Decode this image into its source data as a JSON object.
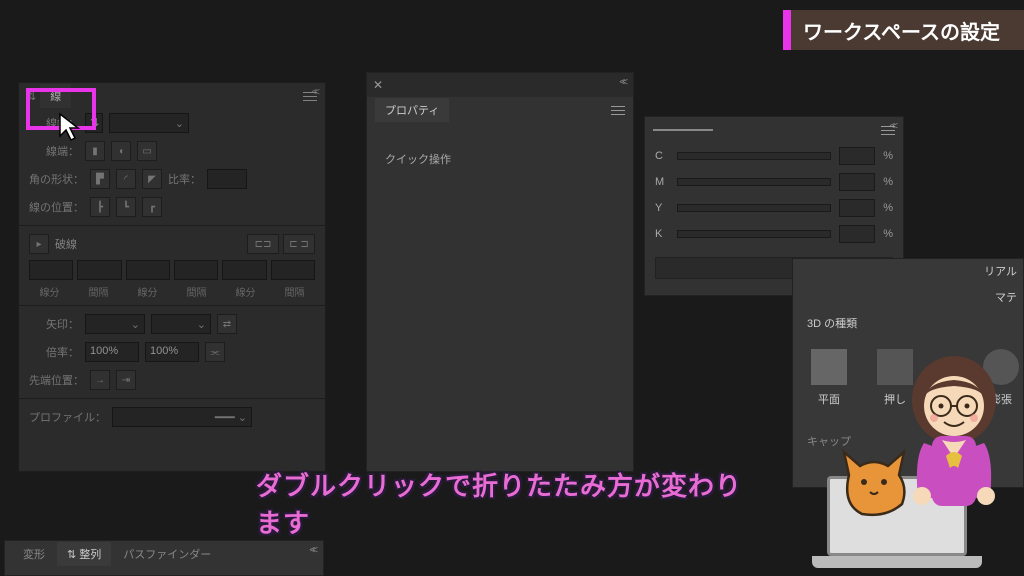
{
  "title_banner": "ワークスペースの設定",
  "subtitle": "ダブルクリックで折りたたみ方が変わります",
  "stroke_panel": {
    "tab": "線",
    "width_label": "線幅：",
    "cap_label": "線端：",
    "corner_label": "角の形状：",
    "ratio_label": "比率：",
    "align_label": "線の位置：",
    "dash_checkbox": "破線",
    "dash_headers": [
      "線分",
      "間隔",
      "線分",
      "間隔",
      "線分",
      "間隔"
    ],
    "arrow_label": "矢印：",
    "scale_label": "倍率：",
    "scale_val1": "100%",
    "scale_val2": "100%",
    "tip_label": "先端位置：",
    "profile_label": "プロファイル："
  },
  "props_panel": {
    "tab": "プロパティ",
    "quick": "クイック操作"
  },
  "color_panel": {
    "channels": [
      {
        "label": "C",
        "pct": "%"
      },
      {
        "label": "M",
        "pct": "%"
      },
      {
        "label": "Y",
        "pct": "%"
      },
      {
        "label": "K",
        "pct": "%"
      }
    ]
  },
  "d3_panel": {
    "side_tab1": "リアル",
    "side_tab2": "マテ",
    "heading": "3D の種類",
    "items": [
      "平面",
      "押し",
      "膨張"
    ],
    "bottom": "キャップ"
  },
  "bottom_tabs": [
    "変形",
    "整列",
    "パスファインダー"
  ]
}
